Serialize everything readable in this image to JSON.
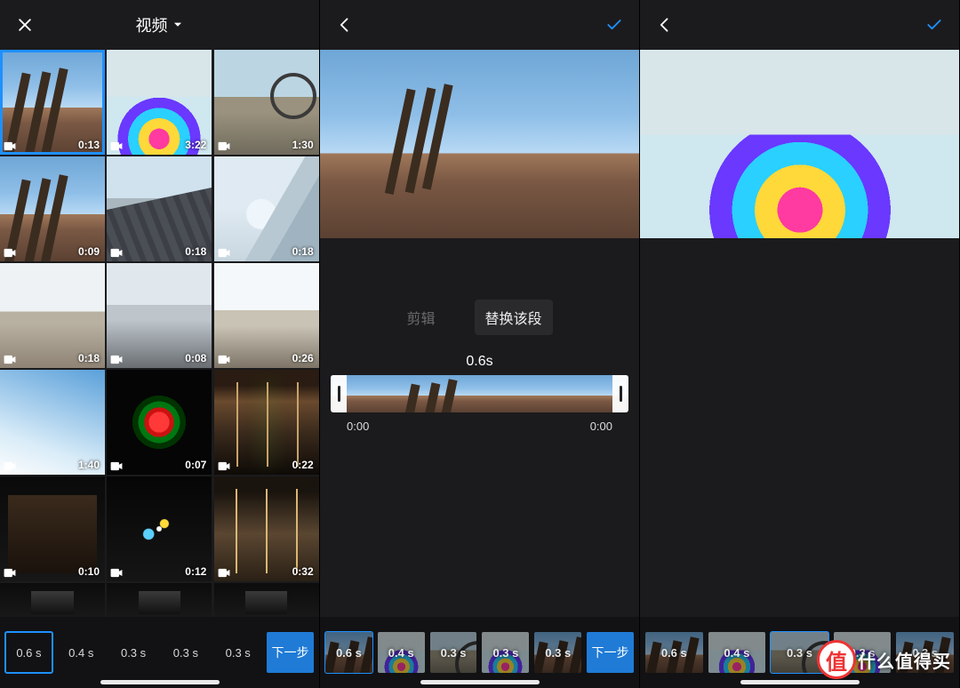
{
  "brand": {
    "watermark_text": "什么值得买",
    "watermark_badge": "值"
  },
  "left": {
    "title": "视频",
    "grid": [
      {
        "dur": "0:13",
        "art": "a1",
        "selected": true
      },
      {
        "dur": "3:22",
        "art": "a2"
      },
      {
        "dur": "1:30",
        "art": "a3"
      },
      {
        "dur": "0:09",
        "art": "a1"
      },
      {
        "dur": "0:18",
        "art": "a4"
      },
      {
        "dur": "0:18",
        "art": "a5"
      },
      {
        "dur": "0:18",
        "art": "a6"
      },
      {
        "dur": "0:08",
        "art": "a7"
      },
      {
        "dur": "0:26",
        "art": "a8"
      },
      {
        "dur": "1:40",
        "art": "a9"
      },
      {
        "dur": "0:07",
        "art": "a10"
      },
      {
        "dur": "0:22",
        "art": "a11"
      },
      {
        "dur": "0:10",
        "art": "a13"
      },
      {
        "dur": "0:12",
        "art": "a12"
      },
      {
        "dur": "0:32",
        "art": "a14"
      }
    ],
    "strip": [
      {
        "label": "0.6 s",
        "selected": true
      },
      {
        "label": "0.4 s"
      },
      {
        "label": "0.3 s"
      },
      {
        "label": "0.3 s"
      },
      {
        "label": "0.3 s"
      }
    ],
    "next_label": "下一步"
  },
  "middle": {
    "tabs": {
      "trim": "剪辑",
      "replace": "替换该段"
    },
    "duration_label": "0.6s",
    "scrub": {
      "start": "0:00",
      "end": "0:00"
    },
    "strip": [
      {
        "label": "0.6 s",
        "art": "a1",
        "selected": true
      },
      {
        "label": "0.4 s",
        "art": "a2"
      },
      {
        "label": "0.3 s",
        "art": "a3"
      },
      {
        "label": "0.3 s",
        "art": "a2"
      },
      {
        "label": "0.3 s",
        "art": "a1"
      }
    ],
    "next_label": "下一步"
  },
  "right": {
    "strip": [
      {
        "label": "0.6 s",
        "art": "a1"
      },
      {
        "label": "0.4 s",
        "art": "a2"
      },
      {
        "label": "0.3 s",
        "art": "a3",
        "selected": true
      },
      {
        "label": "0.3 s",
        "art": "a2"
      },
      {
        "label": "0.3 s",
        "art": "a1"
      }
    ]
  }
}
